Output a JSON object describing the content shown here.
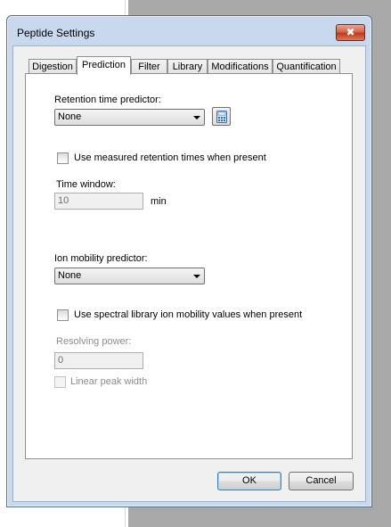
{
  "dialog": {
    "title": "Peptide Settings",
    "close_label": "✖"
  },
  "tabs": [
    {
      "label": "Digestion",
      "active": false
    },
    {
      "label": "Prediction",
      "active": true
    },
    {
      "label": "Filter",
      "active": false
    },
    {
      "label": "Library",
      "active": false
    },
    {
      "label": "Modifications",
      "active": false
    },
    {
      "label": "Quantification",
      "active": false
    }
  ],
  "retention": {
    "label": "Retention time predictor:",
    "value": "None",
    "calculator_icon": "calculator-icon",
    "use_measured_label": "Use measured retention times when present",
    "use_measured_checked": false,
    "time_window_label": "Time window:",
    "time_window_value": "10",
    "time_window_unit": "min"
  },
  "ion_mobility": {
    "label": "Ion mobility predictor:",
    "value": "None",
    "use_library_label": "Use spectral library ion mobility values when present",
    "use_library_checked": false,
    "resolving_power_label": "Resolving power:",
    "resolving_power_value": "0",
    "linear_peak_label": "Linear peak width",
    "linear_peak_checked": false
  },
  "buttons": {
    "ok_label": "OK",
    "cancel_label": "Cancel"
  }
}
